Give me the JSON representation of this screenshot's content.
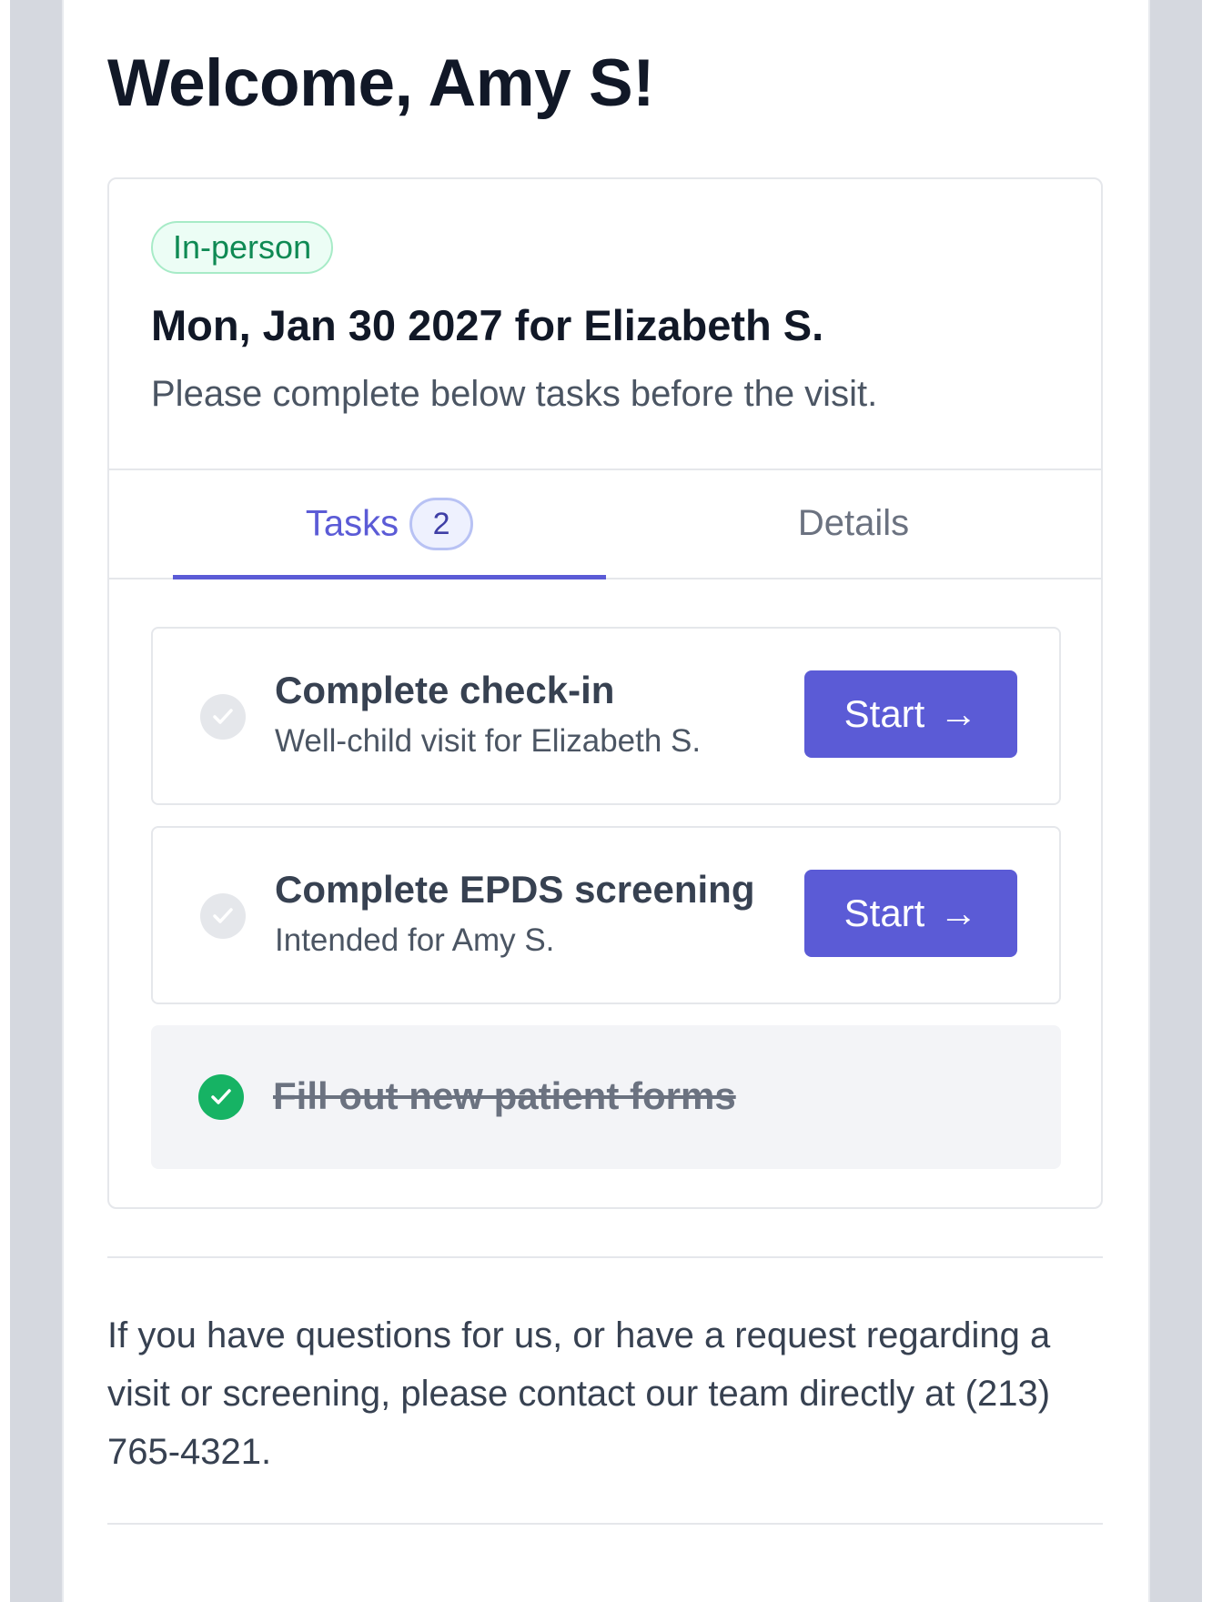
{
  "welcome": "Welcome, Amy S!",
  "visit": {
    "badge": "In-person",
    "date_line": "Mon, Jan 30 2027 for Elizabeth S.",
    "note": "Please complete below tasks before the visit."
  },
  "tabs": {
    "tasks_label": "Tasks",
    "tasks_count": "2",
    "details_label": "Details",
    "active": "Tasks"
  },
  "tasks": [
    {
      "title": "Complete check-in",
      "subtitle": "Well-child visit for Elizabeth S.",
      "button": "Start",
      "done": false
    },
    {
      "title": "Complete EPDS screening",
      "subtitle": "Intended for Amy S.",
      "button": "Start",
      "done": false
    },
    {
      "title": "Fill out new patient forms",
      "done": true
    }
  ],
  "contact_text": "If you have questions for us, or have a request regarding a visit or screening, please contact our team directly at (213) 765-4321.",
  "icons": {
    "pending": "check-icon",
    "done": "check-circle-icon",
    "start": "arrow-right-icon"
  },
  "colors": {
    "accent": "#5b5bd6",
    "success": "#16b364",
    "badge_text": "#0f8a54",
    "side_panel": "#d5d8df"
  }
}
